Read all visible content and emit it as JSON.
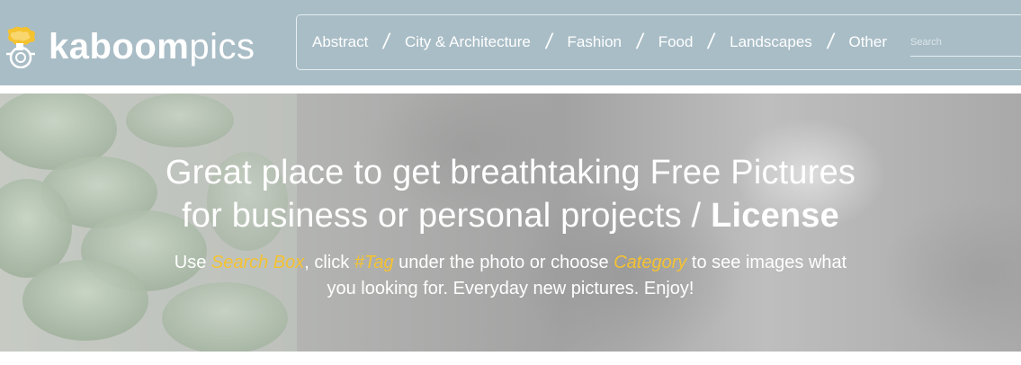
{
  "brand": {
    "name_bold": "kaboom",
    "name_light": "pics",
    "accent_color": "#f5c230"
  },
  "nav": {
    "items": [
      {
        "label": "Abstract"
      },
      {
        "label": "City & Architecture"
      },
      {
        "label": "Fashion"
      },
      {
        "label": "Food"
      },
      {
        "label": "Landscapes"
      },
      {
        "label": "Other"
      }
    ],
    "separator": "/",
    "search": {
      "placeholder": "Search",
      "value": ""
    }
  },
  "hero": {
    "title_line1": "Great place to get breathtaking Free Pictures",
    "title_line2": "for business or personal projects / ",
    "title_link": "License",
    "sub_use": "Use ",
    "sub_search_box": "Search Box",
    "sub_click": ", click ",
    "sub_tag": "#Tag",
    "sub_under": " under the photo or choose ",
    "sub_category": "Category",
    "sub_to_see": " to see images what",
    "sub_line2": "you looking for. Everyday new pictures. Enjoy!"
  },
  "colors": {
    "header_bg": "#a9bdc6",
    "highlight": "#f5c230"
  }
}
